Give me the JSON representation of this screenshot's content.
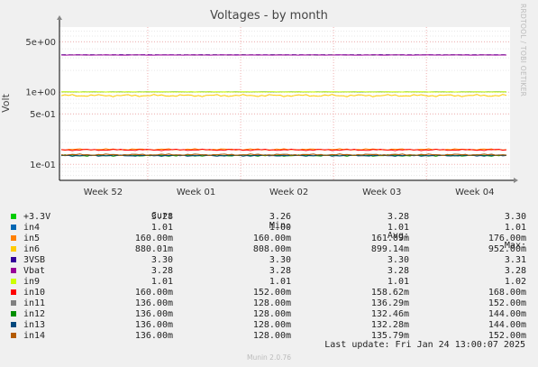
{
  "title": "Voltages - by month",
  "side_label": "RRDTOOL / TOBI OETIKER",
  "footer": {
    "last_update": "Last update: Fri Jan 24 13:00:07 2025",
    "munin": "Munin 2.0.76"
  },
  "legend_headers": {
    "cur": "Cur:",
    "min": "Min:",
    "avg": "Avg:",
    "max": "Max:"
  },
  "chart_data": {
    "type": "line",
    "title": "Voltages - by month",
    "ylabel": "Volt",
    "yscale": "log",
    "ylim": [
      0.06,
      8
    ],
    "yticks": [
      {
        "value": 5,
        "label": "5e+00"
      },
      {
        "value": 1,
        "label": "1e+00"
      },
      {
        "value": 0.5,
        "label": "5e-01"
      },
      {
        "value": 0.1,
        "label": "1e-01"
      }
    ],
    "xticks": [
      "Week 52",
      "Week 01",
      "Week 02",
      "Week 03",
      "Week 04"
    ],
    "grid": true,
    "series": [
      {
        "name": "+3.3V",
        "color": "#00cc00",
        "cur": "3.28",
        "min": "3.26",
        "avg": "3.28",
        "max": "3.30",
        "value": 3.28,
        "dashed": true
      },
      {
        "name": "in4",
        "color": "#0066b3",
        "cur": "1.01",
        "min": "1.00",
        "avg": "1.01",
        "max": "1.01",
        "value": 1.01
      },
      {
        "name": "in5",
        "color": "#ff8000",
        "cur": "160.00m",
        "min": "160.00m",
        "avg": "161.09m",
        "max": "176.00m",
        "value": 0.161
      },
      {
        "name": "in6",
        "color": "#ffcc00",
        "cur": "880.01m",
        "min": "808.00m",
        "avg": "899.14m",
        "max": "952.00m",
        "value": 0.899,
        "noisy": true
      },
      {
        "name": "3VSB",
        "color": "#330099",
        "cur": "3.30",
        "min": "3.30",
        "avg": "3.30",
        "max": "3.31",
        "value": 3.3,
        "dashed": true
      },
      {
        "name": "Vbat",
        "color": "#990099",
        "cur": "3.28",
        "min": "3.28",
        "avg": "3.28",
        "max": "3.28",
        "value": 3.28
      },
      {
        "name": "in9",
        "color": "#ccff00",
        "cur": "1.01",
        "min": "1.01",
        "avg": "1.01",
        "max": "1.02",
        "value": 1.01
      },
      {
        "name": "in10",
        "color": "#ff0000",
        "cur": "160.00m",
        "min": "152.00m",
        "avg": "158.62m",
        "max": "168.00m",
        "value": 0.1586
      },
      {
        "name": "in11",
        "color": "#808080",
        "cur": "136.00m",
        "min": "128.00m",
        "avg": "136.29m",
        "max": "152.00m",
        "value": 0.1363
      },
      {
        "name": "in12",
        "color": "#008f00",
        "cur": "136.00m",
        "min": "128.00m",
        "avg": "132.46m",
        "max": "144.00m",
        "value": 0.1325
      },
      {
        "name": "in13",
        "color": "#00487d",
        "cur": "136.00m",
        "min": "128.00m",
        "avg": "132.28m",
        "max": "144.00m",
        "value": 0.1323
      },
      {
        "name": "in14",
        "color": "#b35a00",
        "cur": "136.00m",
        "min": "128.00m",
        "avg": "135.79m",
        "max": "152.00m",
        "value": 0.1358
      }
    ]
  }
}
